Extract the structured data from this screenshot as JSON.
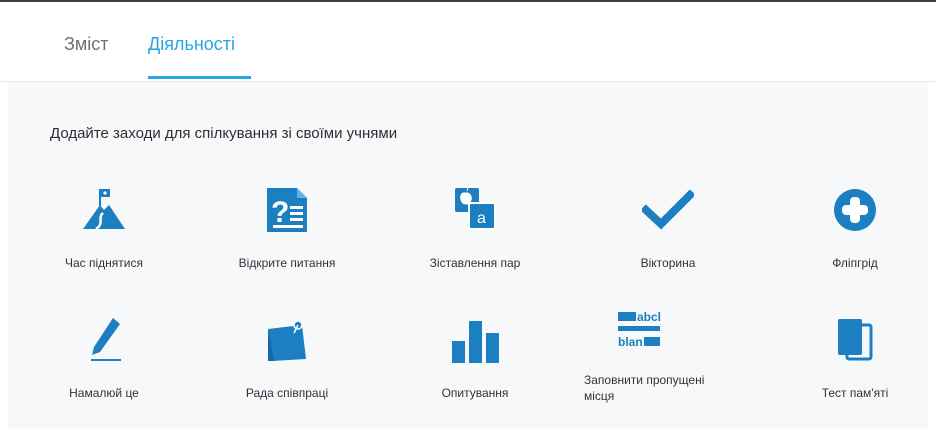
{
  "tabs": [
    {
      "label": "Зміст",
      "active": false
    },
    {
      "label": "Діяльності",
      "active": true
    }
  ],
  "accent_color": "#2aa3e0",
  "panel": {
    "heading": "Додайте заходи для спілкування зі своїми учнями",
    "activities": [
      {
        "label": "Час піднятися",
        "icon": "mountain-flag-icon"
      },
      {
        "label": "Відкрите питання",
        "icon": "open-question-icon"
      },
      {
        "label": "Зіставлення пар",
        "icon": "match-pairs-icon"
      },
      {
        "label": "Вікторина",
        "icon": "checkmark-icon"
      },
      {
        "label": "Фліпгрід",
        "icon": "plus-circle-icon"
      },
      {
        "label": "Намалюй це",
        "icon": "pencil-icon"
      },
      {
        "label": "Рада співпраці",
        "icon": "collaboration-board-icon"
      },
      {
        "label": "Опитування",
        "icon": "bar-chart-icon"
      },
      {
        "label": "Заповнити пропущені місця",
        "icon": "fill-blanks-icon",
        "blank_words": [
          "abcl",
          "blan"
        ]
      },
      {
        "label": "Тест пам'яті",
        "icon": "memory-cards-icon"
      }
    ]
  }
}
